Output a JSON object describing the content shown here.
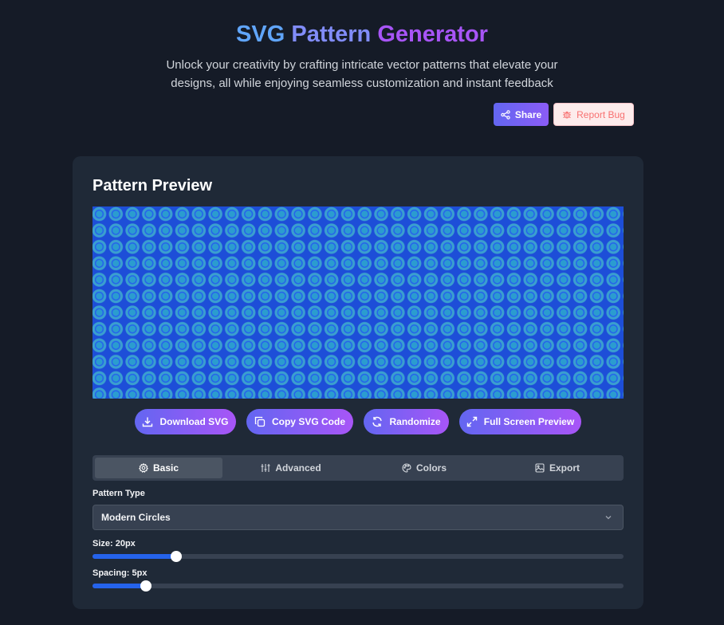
{
  "header": {
    "title_part1": "SVG",
    "title_part2": "Pattern",
    "title_part3": "Generator",
    "subtitle": "Unlock your creativity by crafting intricate vector patterns that elevate your designs, all while enjoying seamless customization and instant feedback",
    "share_label": "Share",
    "report_label": "Report Bug"
  },
  "preview": {
    "title": "Pattern Preview",
    "actions": [
      {
        "label": "Download SVG",
        "icon": "download-icon"
      },
      {
        "label": "Copy SVG Code",
        "icon": "copy-icon"
      },
      {
        "label": "Randomize",
        "icon": "refresh-icon"
      },
      {
        "label": "Full Screen Preview",
        "icon": "expand-icon"
      }
    ]
  },
  "tabs": [
    {
      "label": "Basic",
      "icon": "gear-icon",
      "active": true
    },
    {
      "label": "Advanced",
      "icon": "sliders-icon",
      "active": false
    },
    {
      "label": "Colors",
      "icon": "palette-icon",
      "active": false
    },
    {
      "label": "Export",
      "icon": "image-icon",
      "active": false
    }
  ],
  "controls": {
    "pattern_type_label": "Pattern Type",
    "pattern_type_value": "Modern Circles",
    "size_label": "Size: 20px",
    "size_fraction": 0.158,
    "spacing_label": "Spacing: 5px",
    "spacing_fraction": 0.1
  },
  "colors": {
    "accent": "#6366f1",
    "accent_end": "#a855f7",
    "pattern_bg": "#1d4ed8",
    "pattern_circle": "#3a9fcf",
    "slider_fill": "#2563eb"
  }
}
